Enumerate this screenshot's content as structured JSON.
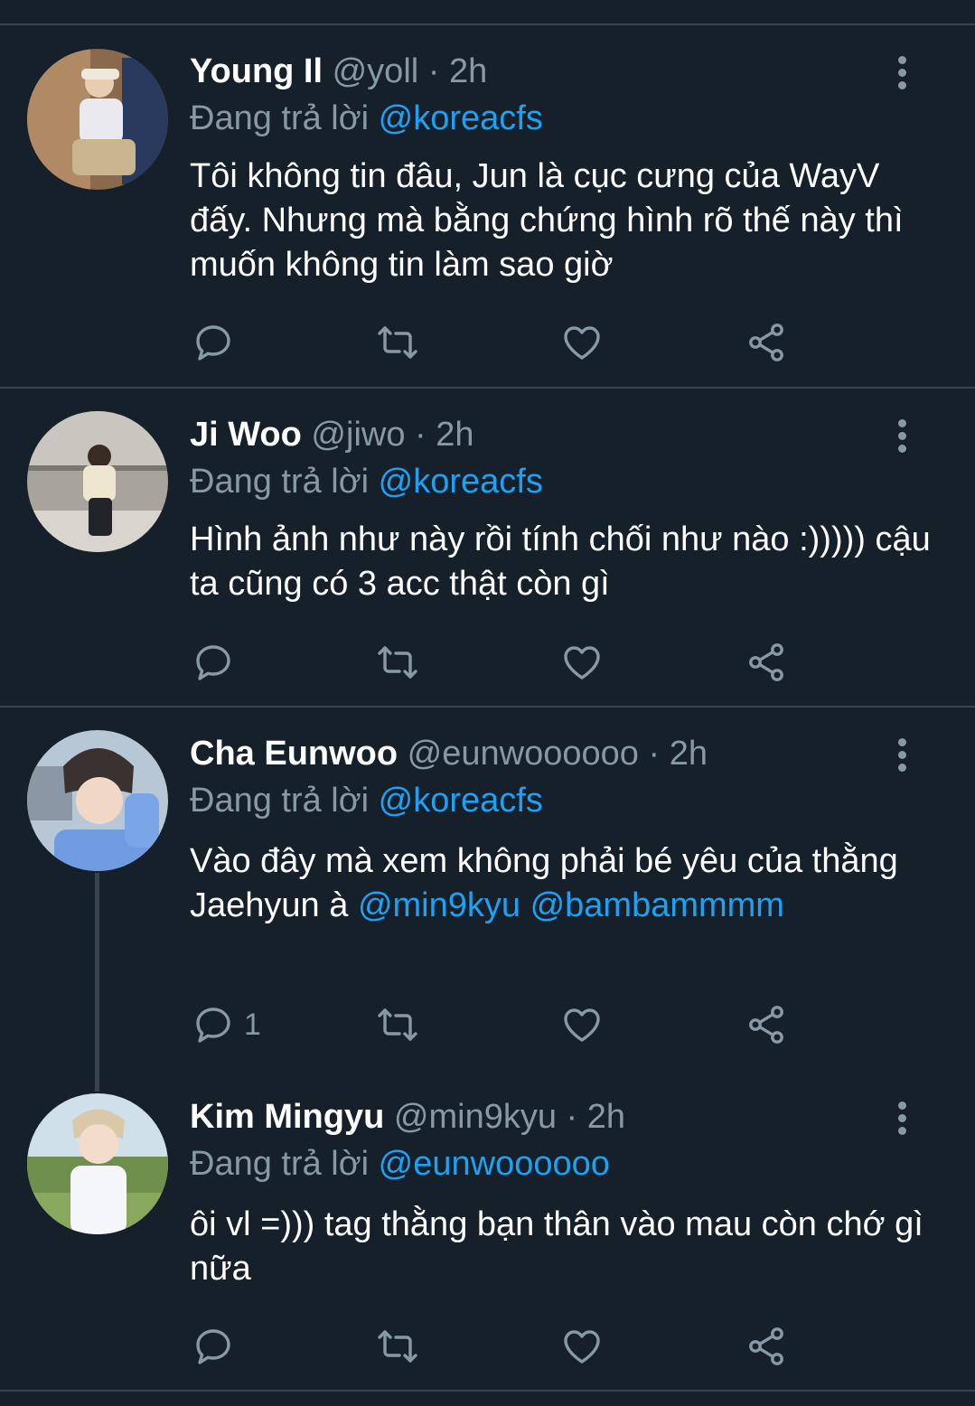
{
  "reply_prefix": "Đang trả lời",
  "colors": {
    "background": "#15202b",
    "muted": "#8899a6",
    "accent": "#1da1f2",
    "divider": "#38444d"
  },
  "tweets": [
    {
      "name": "Young Il",
      "handle": "@yoll",
      "separator": "·",
      "time": "2h",
      "reply_to": "@koreacfs",
      "text": "Tôi không tin đâu, Jun là cục cưng của WayV đấy. Nhưng mà bằng chứng hình rõ thế này thì muốn không tin làm sao giờ",
      "mentions": [],
      "reply_count": ""
    },
    {
      "name": "Ji Woo",
      "handle": "@jiwo",
      "separator": "·",
      "time": "2h",
      "reply_to": "@koreacfs",
      "text": "Hình ảnh như này rồi tính chối như nào :))))) cậu ta cũng có 3 acc thật còn gì",
      "mentions": [],
      "reply_count": ""
    },
    {
      "name": "Cha Eunwoo",
      "handle": "@eunwoooooo",
      "separator": "·",
      "time": "2h",
      "reply_to": "@koreacfs",
      "text": "Vào đây mà xem không phải bé yêu của thằng Jaehyun à",
      "mentions": [
        "@min9kyu",
        "@bambammmm"
      ],
      "reply_count": "1"
    },
    {
      "name": "Kim Mingyu",
      "handle": "@min9kyu",
      "separator": "·",
      "time": "2h",
      "reply_to": "@eunwoooooo",
      "text": "ôi vl =))) tag thằng bạn thân vào mau còn chớ gì nữa",
      "mentions": [],
      "reply_count": ""
    }
  ],
  "icons": {
    "reply": "reply-icon",
    "retweet": "retweet-icon",
    "like": "heart-icon",
    "share": "share-icon",
    "more": "more-vertical-icon"
  }
}
